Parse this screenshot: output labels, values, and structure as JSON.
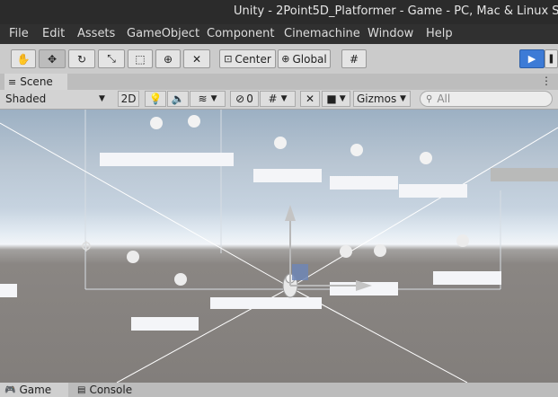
{
  "window": {
    "title": "Unity - 2Point5D_Platformer - Game - PC, Mac & Linux Stan"
  },
  "menu": [
    "File",
    "Edit",
    "Assets",
    "GameObject",
    "Component",
    "Cinemachine",
    "Window",
    "Help"
  ],
  "toolbar": {
    "tools": [
      "hand-tool-icon",
      "move-tool-icon",
      "rotate-tool-icon",
      "scale-tool-icon",
      "rect-tool-icon",
      "transform-tool-icon",
      "custom-tool-icon"
    ],
    "pivot_label": "Center",
    "space_label": "Global",
    "accent": "#3d7bd6"
  },
  "scene_tab": {
    "label": "Scene"
  },
  "scene_toolbar": {
    "draw_mode": "Shaded",
    "mode_2d": "2D",
    "hidden_count": "0",
    "gizmos_label": "Gizmos",
    "search_placeholder": "All"
  },
  "bottom_tabs": [
    "Game",
    "Console"
  ],
  "colors": {
    "sky_top": "#9cb0c3",
    "horizon": "#f2f5f8",
    "ground": "#827e7b",
    "platform": "#f4f5f8"
  }
}
